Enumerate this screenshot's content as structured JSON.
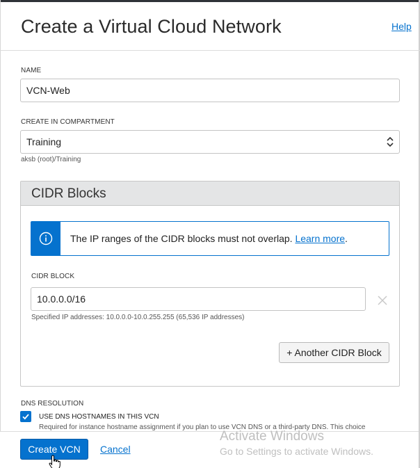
{
  "header": {
    "title": "Create a Virtual Cloud Network",
    "help_label": "Help"
  },
  "form": {
    "name": {
      "label": "NAME",
      "value": "VCN-Web"
    },
    "compartment": {
      "label": "CREATE IN COMPARTMENT",
      "value": "Training",
      "path_hint": "aksb (root)/Training"
    }
  },
  "cidr_blocks": {
    "title": "CIDR Blocks",
    "info": {
      "text": "The IP ranges of the CIDR blocks must not overlap.",
      "link_label": "Learn more",
      "suffix": "."
    },
    "block": {
      "label": "CIDR BLOCK",
      "value": "10.0.0.0/16",
      "hint": "Specified IP addresses: 10.0.0.0-10.0.255.255 (65,536 IP addresses)"
    },
    "add_button_label": "+ Another CIDR Block"
  },
  "dns": {
    "label": "DNS RESOLUTION",
    "checkbox_label": "USE DNS HOSTNAMES IN THIS VCN",
    "checked": true,
    "hint": "Required for instance hostname assignment if you plan to use VCN DNS or a third-party DNS. This choice"
  },
  "footer": {
    "create_label": "Create VCN",
    "cancel_label": "Cancel"
  },
  "watermark": {
    "line1": "Activate Windows",
    "line2": "Go to Settings to activate Windows."
  },
  "colors": {
    "accent": "#0572ce",
    "panel_header": "#e4e5e6"
  },
  "icons": [
    "info-icon",
    "select-arrows-icon",
    "close-icon",
    "checkmark-icon",
    "hand-cursor-icon"
  ]
}
